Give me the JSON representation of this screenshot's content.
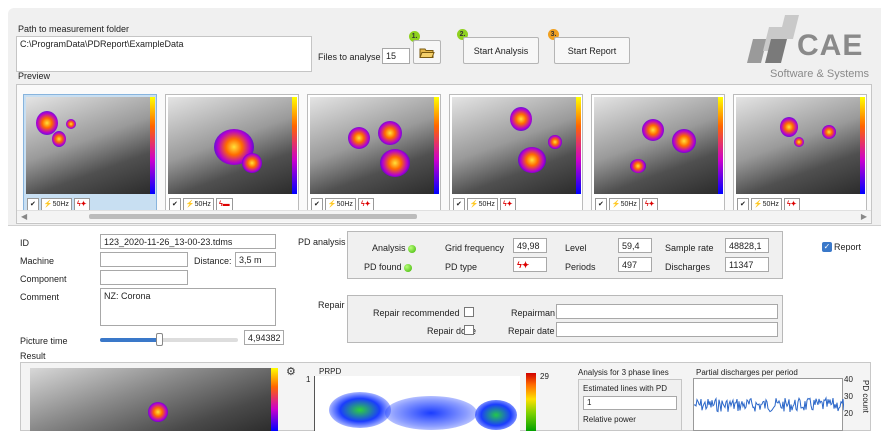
{
  "header": {
    "path_label": "Path to measurement folder",
    "path_value": "C:\\ProgramData\\PDReport\\ExampleData",
    "files_label": "Files to analyse",
    "files_value": "15",
    "step1": "1.",
    "step2": "2.",
    "step3": "3.",
    "start_analysis": "Start Analysis",
    "start_report": "Start Report",
    "logo_text": "CAE",
    "logo_sub": "Software & Systems"
  },
  "preview": {
    "label": "Preview",
    "thumbs": [
      {
        "freq": "50Hz"
      },
      {
        "freq": "50Hz"
      },
      {
        "freq": "50Hz"
      },
      {
        "freq": "50Hz"
      },
      {
        "freq": "50Hz"
      },
      {
        "freq": "50Hz"
      }
    ]
  },
  "details": {
    "id_label": "ID",
    "id_value": "123_2020-11-26_13-00-23.tdms",
    "machine_label": "Machine",
    "machine_value": "",
    "distance_label": "Distance:",
    "distance_value": "3,5 m",
    "component_label": "Component",
    "component_value": "",
    "comment_label": "Comment",
    "comment_value": "NZ: Corona",
    "picture_time_label": "Picture time",
    "picture_time_value": "4,94382",
    "picture_time_slider": 0.43,
    "result_label": "Result"
  },
  "analysis": {
    "label": "PD analysis",
    "analysis_label": "Analysis",
    "pd_found_label": "PD found",
    "grid_freq_label": "Grid frequency",
    "grid_freq_value": "49,98",
    "pd_type_label": "PD type",
    "level_label": "Level",
    "level_value": "59,4",
    "periods_label": "Periods",
    "periods_value": "497",
    "sample_rate_label": "Sample rate",
    "sample_rate_value": "48828,1",
    "discharges_label": "Discharges",
    "discharges_value": "11347",
    "report_label": "Report"
  },
  "repair": {
    "label": "Repair",
    "recommended_label": "Repair recommended",
    "done_label": "Repair done",
    "repairman_label": "Repairman",
    "repairman_value": "",
    "date_label": "Repair date",
    "date_value": ""
  },
  "result": {
    "prpd_title": "PRPD",
    "prpd_y_tick": "1",
    "colorbar_max": "29",
    "phase_title": "Analysis for 3 phase lines",
    "est_lines_label": "Estimated lines with PD",
    "est_lines_value": "1",
    "rel_power_label": "Relative power",
    "ppp_title": "Partial discharges per period",
    "ppp_ticks": [
      "40",
      "30",
      "20"
    ],
    "ppp_axis": "PD count"
  },
  "colors": {
    "accent_blue": "#3a78c9",
    "led_green": "#3bb300",
    "badge_green": "#8fd11f",
    "badge_orange": "#f0a020",
    "logo_gray": "#8a8a8a"
  }
}
